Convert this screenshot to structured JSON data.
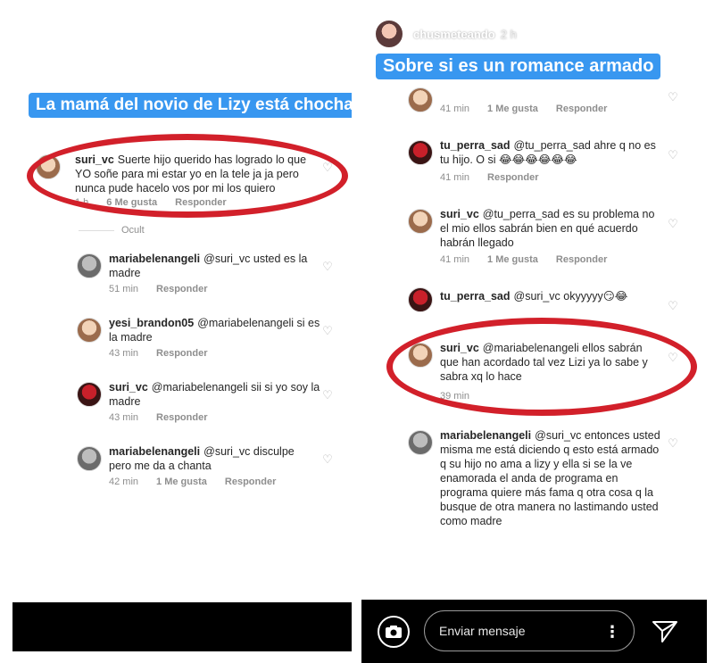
{
  "left_story": {
    "caption": "La mamá del novio de Lizy está chocha",
    "hidden_label": "Ocult",
    "comments": [
      {
        "user": "suri_vc",
        "text": "Suerte hijo querido has logrado lo que YO soñe para mi estar yo en la tele ja ja pero nunca pude hacelo vos por mi los quiero",
        "time": "1 h",
        "likes": "6 Me gusta",
        "reply": "Responder"
      },
      {
        "user": "mariabelenangeli",
        "text": "@suri_vc usted es la madre",
        "time": "51 min",
        "reply": "Responder"
      },
      {
        "user": "yesi_brandon05",
        "text": "@mariabelenangeli si es la madre",
        "time": "43 min",
        "reply": "Responder"
      },
      {
        "user": "suri_vc",
        "text": "@mariabelenangeli  sii si yo soy la madre",
        "time": "43 min",
        "reply": "Responder"
      },
      {
        "user": "mariabelenangeli",
        "text": "@suri_vc disculpe pero me da a chanta",
        "time": "42 min",
        "likes": "1 Me gusta",
        "reply": "Responder"
      }
    ]
  },
  "right_story": {
    "user": "chusmeteando",
    "time": "2 h",
    "caption": "Sobre si es un romance armado",
    "comments": [
      {
        "user": "",
        "text": "",
        "time": "41 min",
        "likes": "1 Me gusta",
        "reply": "Responder"
      },
      {
        "user": "tu_perra_sad",
        "text": "@tu_perra_sad ahre q no es tu hijo. O si 😂😂😂😂😂😂",
        "time": "41 min",
        "reply": "Responder"
      },
      {
        "user": "suri_vc",
        "text": "@tu_perra_sad es su problema no el mio ellos sabrán bien en qué acuerdo habrán llegado",
        "time": "41 min",
        "likes": "1 Me gusta",
        "reply": "Responder"
      },
      {
        "user": "tu_perra_sad",
        "text": "@suri_vc okyyyyy😏😂",
        "time": "",
        "reply": ""
      },
      {
        "user": "suri_vc",
        "text": "@mariabelenangeli ellos sabrán que han acordado tal vez Lizi ya lo sabe y sabra xq lo hace",
        "time": "39 min",
        "reply": ""
      },
      {
        "user": "mariabelenangeli",
        "text": "@suri_vc entonces usted misma me está diciendo q esto está armado q su hijo no ama a lizy y ella si se la ve enamorada el anda de programa en programa quiere más fama q otra cosa q la busque de otra manera no lastimando usted como madre"
      }
    ],
    "message_placeholder": "Enviar mensaje"
  },
  "colors": {
    "caption_bg": "#3897f0",
    "ring": "#d2202a",
    "bar": "#000000"
  },
  "icons": {
    "heart": "heart-icon",
    "camera": "camera-icon",
    "more": "more-vertical-icon",
    "send": "send-icon"
  }
}
